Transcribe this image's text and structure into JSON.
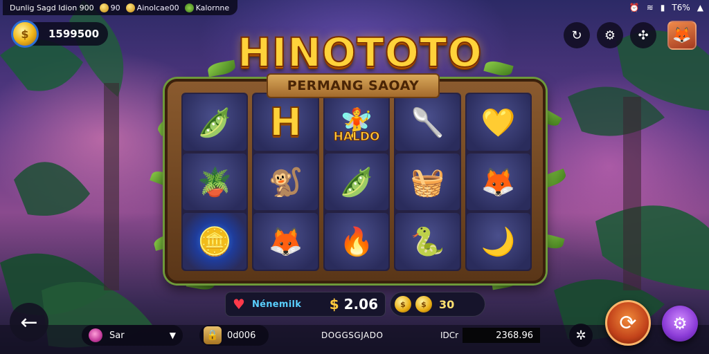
{
  "status_bar": {
    "left_text": "Dunlig Sagd Idion 900",
    "items": [
      {
        "icon": "gold-coin-icon",
        "text": "90"
      },
      {
        "icon": "gold-coin-icon",
        "text": "Ainolcae00"
      },
      {
        "icon": "leaf-badge-icon",
        "text": "Kalornne"
      }
    ],
    "battery": "T6%"
  },
  "balance": {
    "amount": "1599500"
  },
  "game": {
    "title": "HINOTOTO",
    "subtitle": "PERMANG SAOAY",
    "reels": [
      [
        {
          "icon": "pea-pod",
          "sym": "🫛"
        },
        {
          "icon": "flower-pot",
          "sym": "🪴"
        },
        {
          "icon": "gold-coin",
          "sym": "🪙",
          "highlight": true
        }
      ],
      [
        {
          "icon": "letter-h",
          "sym": "H",
          "letter": true
        },
        {
          "icon": "purple-monkey",
          "sym": "🐒"
        },
        {
          "icon": "fox-cross",
          "sym": "🦊"
        }
      ],
      [
        {
          "icon": "fairy-portrait",
          "sym": "🧚",
          "label": "HALDO"
        },
        {
          "icon": "pea-pod",
          "sym": "🫛"
        },
        {
          "icon": "flame-basket",
          "sym": "🔥"
        }
      ],
      [
        {
          "icon": "blue-spoon",
          "sym": "🥄"
        },
        {
          "icon": "wicker-basket",
          "sym": "🧺"
        },
        {
          "icon": "green-snake",
          "sym": "🐍"
        }
      ],
      [
        {
          "icon": "gold-heart-gem",
          "sym": "💛"
        },
        {
          "icon": "fox-wand",
          "sym": "🦊"
        },
        {
          "icon": "banana",
          "sym": "🌙"
        }
      ]
    ]
  },
  "info_bar": {
    "player": "Nénemilk",
    "currency": "$",
    "winnings": "2.06",
    "coins": "30"
  },
  "bottom": {
    "select_value": "Sar",
    "lock_value": "0d006",
    "code_label": "DOGGSGJADO",
    "balance_label": "IDCr",
    "balance_value": "2368.96"
  },
  "colors": {
    "title_gold": "#ffd23a",
    "spin_button": "#c2421a",
    "settings_button": "#8a3ad6"
  }
}
